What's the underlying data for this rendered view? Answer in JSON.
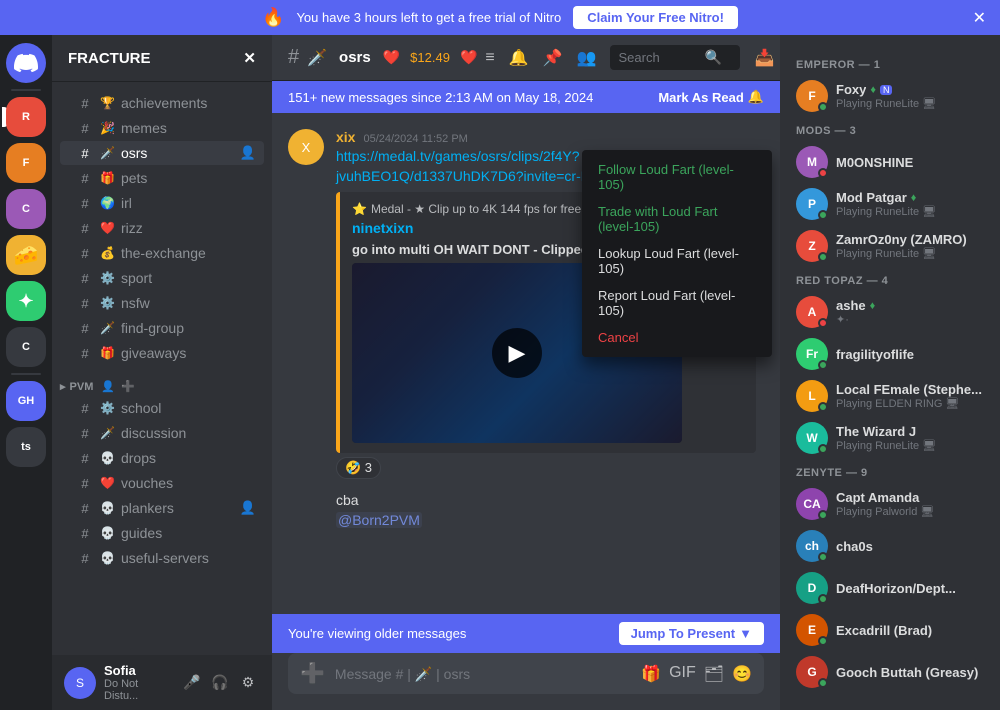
{
  "app": {
    "title": "Discord"
  },
  "nitro_banner": {
    "text": "You have 3 hours left to get a free trial of Nitro",
    "claim_label": "Claim Your Free Nitro!",
    "icon": "🔥"
  },
  "server": {
    "name": "FRACTURE",
    "dropdown_icon": "▾"
  },
  "channels": {
    "top": [
      {
        "id": "achievements",
        "name": "achievements",
        "emoji": "🏆",
        "hash": "#"
      },
      {
        "id": "memes",
        "name": "memes",
        "emoji": "🎉",
        "hash": "#"
      },
      {
        "id": "osrs",
        "name": "osrs",
        "emoji": "🗡️",
        "hash": "#",
        "active": true
      },
      {
        "id": "pets",
        "name": "pets",
        "emoji": "🎁",
        "hash": "#"
      },
      {
        "id": "irl",
        "name": "irl",
        "emoji": "🌍",
        "hash": "#"
      },
      {
        "id": "rizz",
        "name": "rizz",
        "emoji": "❤️",
        "hash": "#"
      },
      {
        "id": "the-exchange",
        "name": "the-exchange",
        "emoji": "💰",
        "hash": "#"
      },
      {
        "id": "sport",
        "name": "sport",
        "emoji": "⚙️",
        "hash": "#"
      },
      {
        "id": "nsfw",
        "name": "nsfw",
        "emoji": "⚙️",
        "hash": "#"
      },
      {
        "id": "find-group",
        "name": "find-group",
        "emoji": "🗡️",
        "hash": "#"
      },
      {
        "id": "giveaways",
        "name": "giveaways",
        "emoji": "🎁",
        "hash": "#"
      }
    ],
    "pvm_category": "PVM",
    "pvm": [
      {
        "id": "school",
        "name": "school",
        "emoji": "⚙️",
        "hash": "#"
      },
      {
        "id": "discussion",
        "name": "discussion",
        "emoji": "🗡️",
        "hash": "#"
      },
      {
        "id": "drops",
        "name": "drops",
        "emoji": "💀",
        "hash": "#"
      },
      {
        "id": "vouches",
        "name": "vouches",
        "emoji": "❤️",
        "hash": "#"
      },
      {
        "id": "plankers",
        "name": "plankers",
        "emoji": "💀",
        "hash": "#"
      },
      {
        "id": "guides",
        "name": "guides",
        "emoji": "💀",
        "hash": "#"
      },
      {
        "id": "useful-servers",
        "name": "useful-servers",
        "emoji": "💀",
        "hash": "#"
      }
    ]
  },
  "user_area": {
    "name": "Sofia",
    "status": "Do Not Distu...",
    "avatar_text": "S"
  },
  "chat": {
    "channel_name": "osrs",
    "channel_balance": "$12.49",
    "new_messages_text": "151+ new messages since 2:13 AM on May 18, 2024",
    "mark_read": "Mark As Read",
    "viewing_older": "You're viewing older messages",
    "jump_to_present": "Jump To Present",
    "input_placeholder": "Message # | 🗡️ | osrs"
  },
  "context_menu": {
    "items": [
      {
        "label": "Follow Loud Fart (level-105)",
        "color": "green"
      },
      {
        "label": "Trade with Loud Fart (level-105)",
        "color": "green"
      },
      {
        "label": "Lookup Loud Fart (level-105)",
        "color": "default"
      },
      {
        "label": "Report Loud Fart (level-105)",
        "color": "default"
      },
      {
        "label": "Cancel",
        "color": "red"
      }
    ]
  },
  "messages": [
    {
      "id": "msg1",
      "author": "xix",
      "author_color": "yellow",
      "time": "05/24/2024 11:52 PM",
      "link": "https://medal.tv/games/osrs/clips/2f4Y?jvuhBEO1Q/d1337UhDK7D6?invite=cr-MSxLQXosNDY4MTM5NTEs",
      "embed_site": "Medal - ★ Clip up to 4K 144 fps for free!",
      "embed_title": "ninetxixn",
      "embed_desc": "go into multi OH WAIT DONT - Clipped with Medal.tv",
      "has_video": true
    },
    {
      "id": "msg2",
      "reaction_emoji": "🤣",
      "reaction_count": "3"
    },
    {
      "id": "msg3",
      "text": "cba",
      "mention": "@Born2PVM",
      "author": "",
      "time": ""
    }
  ],
  "members": {
    "categories": [
      {
        "name": "EMPEROR — 1",
        "members": [
          {
            "name": "Foxy",
            "badge": "♦",
            "status": "online",
            "game": "Playing RuneLite",
            "avatar_bg": "#e67e22",
            "avatar_text": "F"
          }
        ]
      },
      {
        "name": "MODS — 3",
        "members": [
          {
            "name": "M0ONSHINE",
            "badge": "",
            "status": "dnd",
            "game": "",
            "avatar_bg": "#9b59b6",
            "avatar_text": "M"
          },
          {
            "name": "Mod Patgar",
            "badge": "♦",
            "status": "online",
            "game": "Playing RuneLite",
            "avatar_bg": "#3498db",
            "avatar_text": "P"
          },
          {
            "name": "ZamrOz0ny (ZAMRO)",
            "badge": "",
            "status": "online",
            "game": "Playing RuneLite",
            "avatar_bg": "#e74c3c",
            "avatar_text": "Z"
          }
        ]
      },
      {
        "name": "RED TOPAZ — 4",
        "members": [
          {
            "name": "ashe",
            "badge": "♦",
            "status": "dnd",
            "game": "✦·",
            "avatar_bg": "#e74c3c",
            "avatar_text": "A"
          },
          {
            "name": "fragilityoflife",
            "badge": "",
            "status": "online",
            "game": "",
            "avatar_bg": "#2ecc71",
            "avatar_text": "Fr"
          },
          {
            "name": "Local FEmale (Stephe...",
            "badge": "",
            "status": "online",
            "game": "Playing ELDEN RING",
            "avatar_bg": "#f39c12",
            "avatar_text": "L"
          },
          {
            "name": "The Wizard J",
            "badge": "",
            "status": "online",
            "game": "Playing RuneLite",
            "avatar_bg": "#1abc9c",
            "avatar_text": "W"
          }
        ]
      },
      {
        "name": "ZENYTE — 9",
        "members": [
          {
            "name": "Capt Amanda",
            "badge": "",
            "status": "online",
            "game": "Playing Palworld",
            "avatar_bg": "#8e44ad",
            "avatar_text": "CA"
          },
          {
            "name": "cha0s",
            "badge": "",
            "status": "online",
            "game": "",
            "avatar_bg": "#2980b9",
            "avatar_text": "ch"
          },
          {
            "name": "DeafHorizon/Dept...",
            "badge": "",
            "status": "online",
            "game": "",
            "avatar_bg": "#16a085",
            "avatar_text": "D"
          },
          {
            "name": "Excadrill (Brad)",
            "badge": "",
            "status": "online",
            "game": "",
            "avatar_bg": "#d35400",
            "avatar_text": "E"
          },
          {
            "name": "Gooch Buttah (Greasy)",
            "badge": "",
            "status": "online",
            "game": "",
            "avatar_bg": "#c0392b",
            "avatar_text": "G"
          }
        ]
      }
    ]
  },
  "search": {
    "placeholder": "Search"
  },
  "servers_left": [
    {
      "text": "D",
      "bg": "#5865f2",
      "is_discord": true
    },
    {
      "text": "R",
      "bg": "#e74c3c"
    },
    {
      "text": "F",
      "bg": "#e67e22"
    },
    {
      "text": "C",
      "bg": "#9b59b6"
    },
    {
      "text": "🧀",
      "bg": "#f0b232",
      "label": "CHEESE"
    },
    {
      "text": "✦",
      "bg": "#2ecc71"
    },
    {
      "text": "C",
      "bg": "#36393f"
    },
    {
      "text": "GH",
      "bg": "#5865f2"
    },
    {
      "text": "ts",
      "bg": "#36393f"
    }
  ]
}
